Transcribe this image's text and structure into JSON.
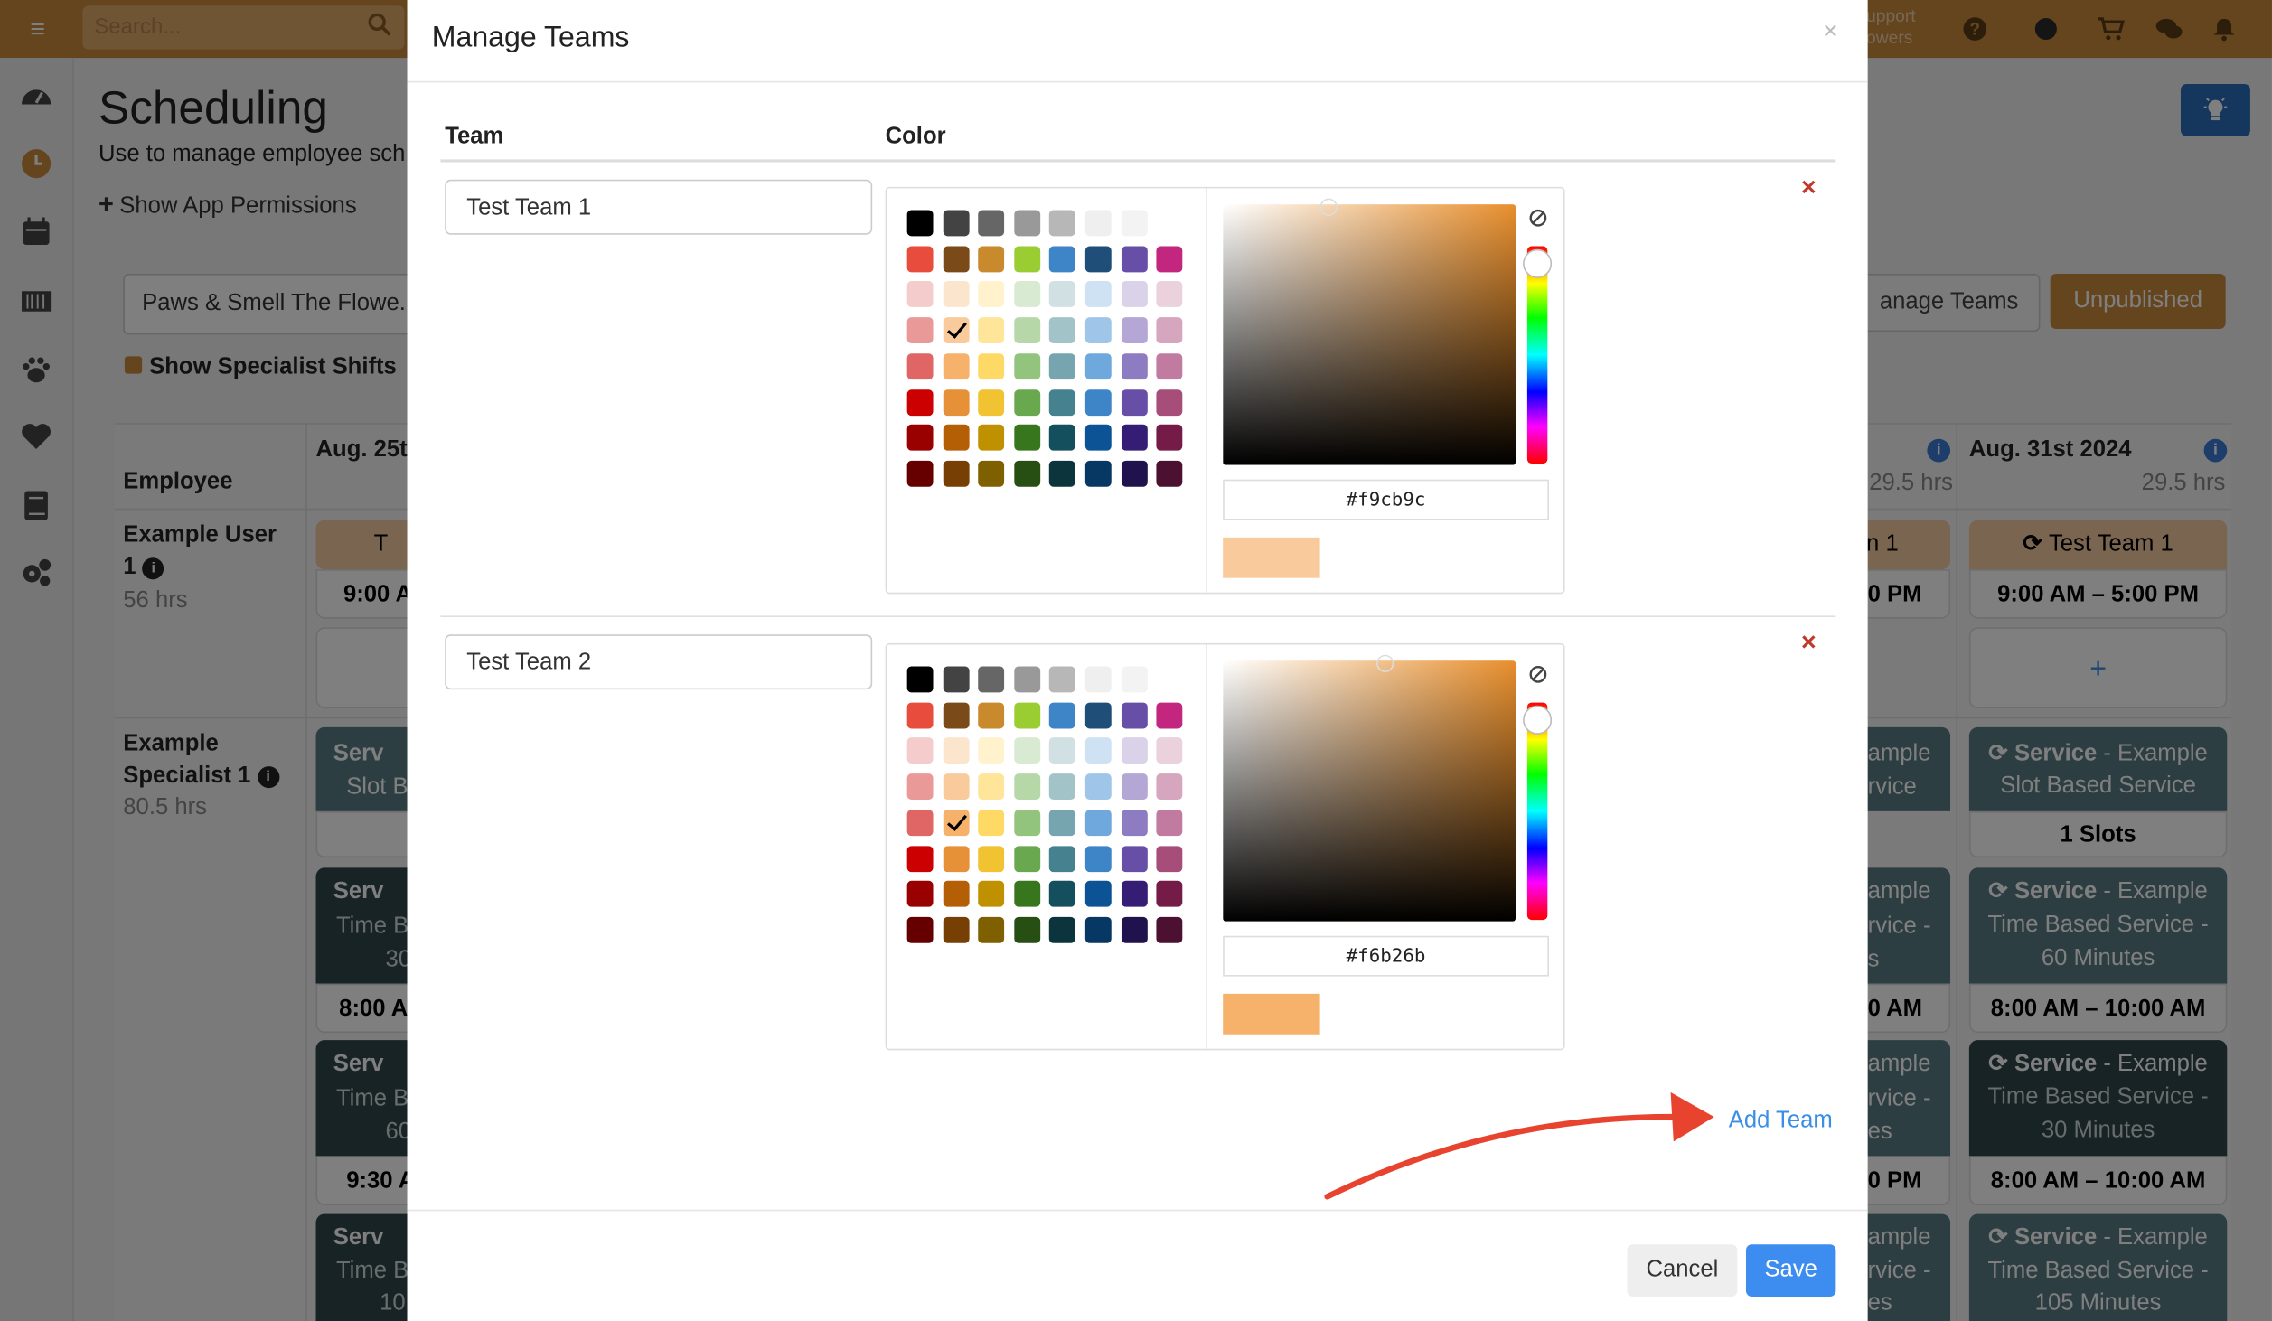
{
  "header": {
    "search_placeholder": "Search...",
    "support_line1": "upport",
    "support_line2": "owers"
  },
  "page": {
    "title": "Scheduling",
    "subtitle": "Use to manage employee sch",
    "permissions_link": "Show App Permissions",
    "location_select": "Paws & Smell The Flowe...",
    "show_specialist": "Show Specialist Shifts",
    "manage_teams_button": "anage Teams",
    "unpublished_button": "Unpublished"
  },
  "schedule": {
    "employee_header": "Employee",
    "days": [
      {
        "label": "Aug. 25t",
        "hours": ""
      },
      {
        "label": "",
        "hours": "29.5 hrs"
      },
      {
        "label": "Aug. 31st 2024",
        "hours": "29.5 hrs"
      }
    ],
    "employees": [
      {
        "name_line1": "Example User",
        "name_line2": "1",
        "hours": "56 hrs"
      },
      {
        "name_line1": "Example",
        "name_line2": "Specialist 1",
        "hours": "80.5 hrs"
      }
    ],
    "cells": {
      "left_team": "T",
      "left_time": "9:00 A",
      "mid_team": "n 1",
      "mid_time": "0 PM",
      "right_team": "Test Team 1",
      "right_time": "9:00 AM – 5:00 PM",
      "add_symbol": "+",
      "svc1_left_a": "Serv",
      "svc1_left_b": "Slot B",
      "svc1_mid_a": "ample",
      "svc1_mid_b": "rvice",
      "svc1_right_a_bold": "Service",
      "svc1_right_a": " - Example",
      "svc1_right_b": "Slot Based Service",
      "svc1_right_slots": "1 Slots",
      "svc2_left_a": "Serv",
      "svc2_left_b": "Time B",
      "svc2_left_c": "30",
      "svc2_left_time": "8:00 A",
      "svc2_mid_a": "ample",
      "svc2_mid_b": "rvice -",
      "svc2_mid_c": "s",
      "svc2_mid_time": "0 AM",
      "svc2_right_a_bold": "Service",
      "svc2_right_a": " - Example",
      "svc2_right_b": "Time Based Service -",
      "svc2_right_c": "60 Minutes",
      "svc2_right_time": "8:00 AM – 10:00 AM",
      "svc3_left_a": "Serv",
      "svc3_left_b": "Time B",
      "svc3_left_c": "60",
      "svc3_left_time": "9:30 A",
      "svc3_mid_a": "ample",
      "svc3_mid_b": "rvice -",
      "svc3_mid_c": "es",
      "svc3_mid_time": "0 PM",
      "svc3_right_a_bold": "Service",
      "svc3_right_a": " - Example",
      "svc3_right_b": "Time Based Service -",
      "svc3_right_c": "30 Minutes",
      "svc3_right_time": "8:00 AM – 10:00 AM",
      "svc4_left_a": "Serv",
      "svc4_left_b": "Time B",
      "svc4_left_c": "10",
      "svc4_mid_a": "ample",
      "svc4_mid_b": "rvice -",
      "svc4_mid_c": "es",
      "svc4_right_a_bold": "Service",
      "svc4_right_a": " - Example",
      "svc4_right_b": "Time Based Service -",
      "svc4_right_c": "105 Minutes"
    }
  },
  "modal": {
    "title": "Manage Teams",
    "close": "×",
    "col_team": "Team",
    "col_color": "Color",
    "teams": [
      {
        "name": "Test Team 1",
        "hex": "#f9cb9c",
        "selected_swatch": "r3c1",
        "hue_value": "orange"
      },
      {
        "name": "Test Team 2",
        "hex": "#f6b26b",
        "selected_swatch": "r4c1",
        "hue_value": "orange"
      }
    ],
    "remove_symbol": "×",
    "add_team": "Add Team",
    "cancel": "Cancel",
    "save": "Save"
  },
  "palette": [
    [
      "#000000",
      "#434343",
      "#666666",
      "#999999",
      "#b7b7b7",
      "#efefef",
      "#f3f3f3",
      "#ffffff"
    ],
    [
      "#e74c3c",
      "#7a4a18",
      "#c98a2e",
      "#9acd32",
      "#3d85c6",
      "#1f4e79",
      "#674ea7",
      "#c2267e"
    ],
    [
      "#f4cccc",
      "#fce5cd",
      "#fff2cc",
      "#d9ead3",
      "#d0e0e3",
      "#cfe2f3",
      "#d9d2e9",
      "#ead1dc"
    ],
    [
      "#ea9999",
      "#f9cb9c",
      "#ffe599",
      "#b6d7a8",
      "#a2c4c9",
      "#9fc5e8",
      "#b4a7d6",
      "#d5a6bd"
    ],
    [
      "#e06666",
      "#f6b26b",
      "#ffd966",
      "#93c47d",
      "#76a5af",
      "#6fa8dc",
      "#8e7cc3",
      "#c27ba0"
    ],
    [
      "#cc0000",
      "#e69138",
      "#f1c232",
      "#6aa84f",
      "#45818e",
      "#3d85c6",
      "#674ea7",
      "#a64d79"
    ],
    [
      "#990000",
      "#b45f06",
      "#bf9000",
      "#38761d",
      "#134f5c",
      "#0b5394",
      "#351c75",
      "#741b47"
    ],
    [
      "#660000",
      "#783f04",
      "#7f6000",
      "#274e13",
      "#0c343d",
      "#073763",
      "#20124d",
      "#4c1130"
    ]
  ],
  "colors": {
    "brand": "#c98a3d",
    "primary": "#3d8df1",
    "link": "#3a8ee6",
    "danger": "#c0392b",
    "annotation_arrow": "#e8432e"
  }
}
